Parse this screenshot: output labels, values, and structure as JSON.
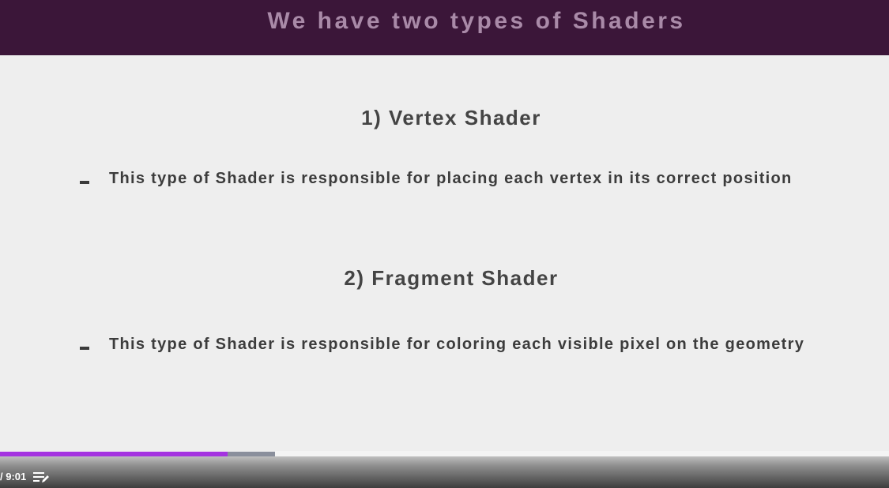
{
  "slide": {
    "title": "We have two types of Shaders",
    "sections": [
      {
        "heading": "1) Vertex Shader",
        "bullet": "This type of Shader is responsible for placing each vertex in its correct position"
      },
      {
        "heading": "2) Fragment Shader",
        "bullet": "This type of Shader is responsible for coloring each visible pixel on the geometry"
      }
    ],
    "colors": {
      "header_bg": "#3b1639",
      "title_text": "#a98aa8",
      "body_bg": "#eeeeee",
      "body_text": "#444444"
    }
  },
  "player": {
    "time_display": "/ 9:01",
    "played_fraction": 0.256,
    "buffered_fraction": 0.309,
    "notes_icon": "add-note-icon",
    "colors": {
      "played": "#a433e0",
      "buffered": "#8a8f9c"
    }
  }
}
